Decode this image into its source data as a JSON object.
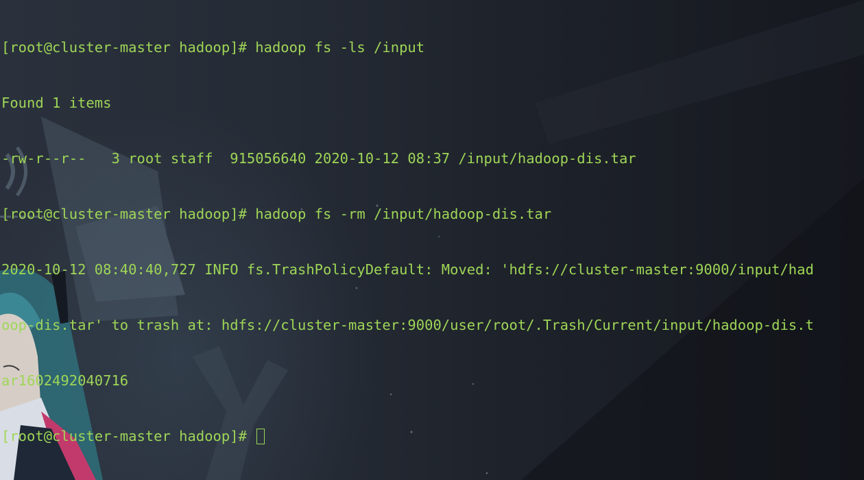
{
  "terminal": {
    "colors": {
      "text": "#9fd657",
      "background": "#1b1e26"
    },
    "lines": [
      "[root@cluster-master hadoop]# hadoop fs -ls /input",
      "Found 1 items",
      "-rw-r--r--   3 root staff  915056640 2020-10-12 08:37 /input/hadoop-dis.tar",
      "[root@cluster-master hadoop]# hadoop fs -rm /input/hadoop-dis.tar",
      "2020-10-12 08:40:40,727 INFO fs.TrashPolicyDefault: Moved: 'hdfs://cluster-master:9000/input/had",
      "oop-dis.tar' to trash at: hdfs://cluster-master:9000/user/root/.Trash/Current/input/hadoop-dis.t",
      "ar1602492040716"
    ],
    "prompt": "[root@cluster-master hadoop]# ",
    "wallpaper_icon": "anime-wallpaper-icon"
  }
}
